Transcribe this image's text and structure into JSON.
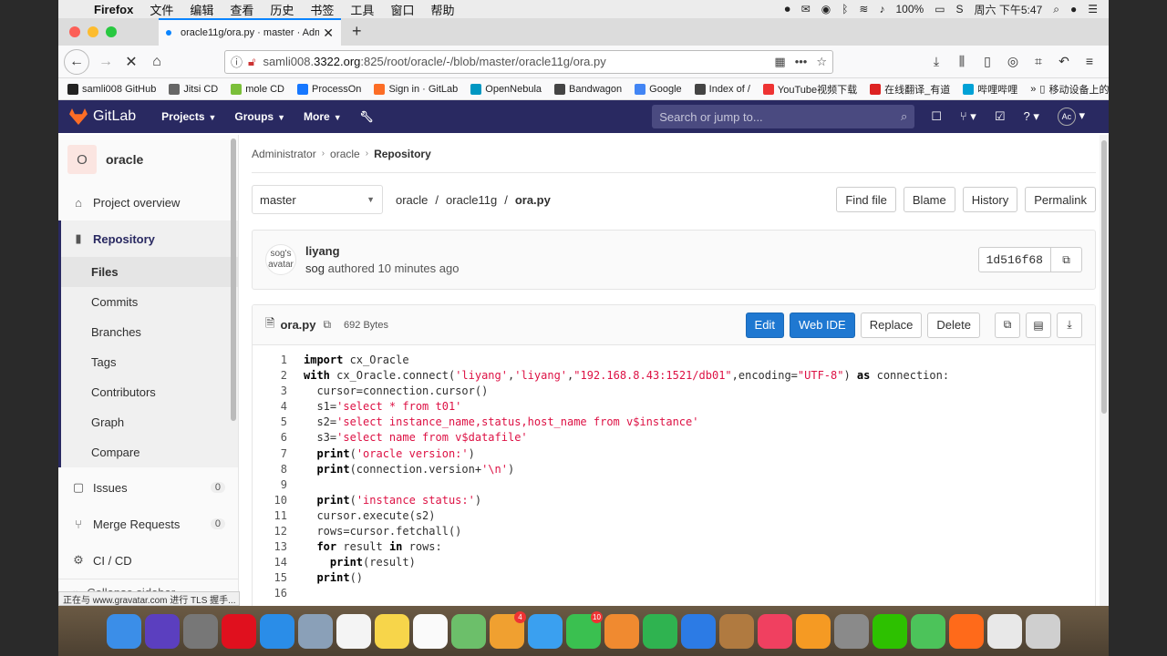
{
  "menubar": {
    "app": "Firefox",
    "items": [
      "文件",
      "编辑",
      "查看",
      "历史",
      "书签",
      "工具",
      "窗口",
      "帮助"
    ],
    "battery": "100%",
    "clock": "周六 下午5:47"
  },
  "browser": {
    "tab_title": "oracle11g/ora.py · master · Adm",
    "url_prefix": "samli008.",
    "url_host": "3322.org",
    "url_rest": ":825/root/oracle/-/blob/master/oracle11g/ora.py",
    "bookmarks": [
      {
        "label": "samli008 GitHub",
        "color": "#222"
      },
      {
        "label": "Jitsi CD",
        "color": "#666"
      },
      {
        "label": "mole CD",
        "color": "#7bbf3a"
      },
      {
        "label": "ProcessOn",
        "color": "#1677ff"
      },
      {
        "label": "Sign in · GitLab",
        "color": "#fc6d26"
      },
      {
        "label": "OpenNebula",
        "color": "#0097c2"
      },
      {
        "label": "Bandwagon",
        "color": "#444"
      },
      {
        "label": "Google",
        "color": "#4285f4"
      },
      {
        "label": "Index of /",
        "color": "#444"
      },
      {
        "label": "YouTube视频下载",
        "color": "#e33"
      },
      {
        "label": "在线翻译_有道",
        "color": "#d22"
      },
      {
        "label": "哔哩哔哩",
        "color": "#00a1d6"
      }
    ],
    "bookmarks_more": "移动设备上的书签",
    "status": "正在与 www.gravatar.com 进行 TLS 握手..."
  },
  "gitlab": {
    "brand": "GitLab",
    "menu": [
      "Projects",
      "Groups",
      "More"
    ],
    "search_placeholder": "Search or jump to...",
    "user_initials": "Ac",
    "project_initial": "O",
    "project_name": "oracle",
    "sidebar": {
      "overview": "Project overview",
      "repository": "Repository",
      "sub": [
        "Files",
        "Commits",
        "Branches",
        "Tags",
        "Contributors",
        "Graph",
        "Compare"
      ],
      "issues": "Issues",
      "issues_count": "0",
      "merge_requests": "Merge Requests",
      "mr_count": "0",
      "cicd": "CI / CD",
      "collapse": "Collapse sidebar"
    },
    "breadcrumb": [
      "Administrator",
      "oracle",
      "Repository"
    ],
    "branch": "master",
    "path": [
      "oracle",
      "oracle11g",
      "ora.py"
    ],
    "actions": [
      "Find file",
      "Blame",
      "History",
      "Permalink"
    ],
    "commit": {
      "avatar_alt": "sog's avatar",
      "title": "liyang",
      "author": "sog",
      "meta": "authored 10 minutes ago",
      "sha": "1d516f68"
    },
    "file": {
      "name": "ora.py",
      "size": "692 Bytes",
      "edit": "Edit",
      "webide": "Web IDE",
      "replace": "Replace",
      "delete": "Delete"
    }
  },
  "code": [
    [
      {
        "k": "import"
      },
      {
        "t": " cx_Oracle"
      }
    ],
    [
      {
        "k": "with"
      },
      {
        "t": " cx_Oracle.connect("
      },
      {
        "s": "'liyang'"
      },
      {
        "t": ","
      },
      {
        "s": "'liyang'"
      },
      {
        "t": ","
      },
      {
        "s": "\"192.168.8.43:1521/db01\""
      },
      {
        "t": ",encoding="
      },
      {
        "s": "\"UTF-8\""
      },
      {
        "t": ") "
      },
      {
        "k": "as"
      },
      {
        "t": " connection:"
      }
    ],
    [
      {
        "t": "  cursor=connection.cursor()"
      }
    ],
    [
      {
        "t": "  s1="
      },
      {
        "s": "'select * from t01'"
      }
    ],
    [
      {
        "t": "  s2="
      },
      {
        "s": "'select instance_name,status,host_name from v$instance'"
      }
    ],
    [
      {
        "t": "  s3="
      },
      {
        "s": "'select name from v$datafile'"
      }
    ],
    [
      {
        "t": "  "
      },
      {
        "k": "print"
      },
      {
        "t": "("
      },
      {
        "s": "'oracle version:'"
      },
      {
        "t": ")"
      }
    ],
    [
      {
        "t": "  "
      },
      {
        "k": "print"
      },
      {
        "t": "(connection.version+"
      },
      {
        "s": "'\\n'"
      },
      {
        "t": ")"
      }
    ],
    [
      {
        "t": ""
      }
    ],
    [
      {
        "t": "  "
      },
      {
        "k": "print"
      },
      {
        "t": "("
      },
      {
        "s": "'instance status:'"
      },
      {
        "t": ")"
      }
    ],
    [
      {
        "t": "  cursor.execute(s2)"
      }
    ],
    [
      {
        "t": "  rows=cursor.fetchall()"
      }
    ],
    [
      {
        "t": "  "
      },
      {
        "k": "for"
      },
      {
        "t": " result "
      },
      {
        "k": "in"
      },
      {
        "t": " rows:"
      }
    ],
    [
      {
        "t": "    "
      },
      {
        "k": "print"
      },
      {
        "t": "(result)"
      }
    ],
    [
      {
        "t": "  "
      },
      {
        "k": "print"
      },
      {
        "t": "()"
      }
    ],
    [
      {
        "t": ""
      }
    ]
  ],
  "dock": [
    {
      "name": "finder-icon",
      "color": "#3b8ee8",
      "badge": ""
    },
    {
      "name": "siri-icon",
      "color": "#5b3fbf",
      "badge": ""
    },
    {
      "name": "launchpad-icon",
      "color": "#777",
      "badge": ""
    },
    {
      "name": "opera-icon",
      "color": "#e0101e",
      "badge": ""
    },
    {
      "name": "safari-icon",
      "color": "#2a8de8",
      "badge": ""
    },
    {
      "name": "preview-icon",
      "color": "#8aa0b8",
      "badge": ""
    },
    {
      "name": "calendar-icon",
      "color": "#f4f4f4",
      "badge": ""
    },
    {
      "name": "notes-icon",
      "color": "#f7d54a",
      "badge": ""
    },
    {
      "name": "reminders-icon",
      "color": "#fafafa",
      "badge": ""
    },
    {
      "name": "maps-icon",
      "color": "#6cbf6a",
      "badge": ""
    },
    {
      "name": "photos-icon",
      "color": "#f0a030",
      "badge": "4"
    },
    {
      "name": "messages-icon",
      "color": "#3aa0f0",
      "badge": ""
    },
    {
      "name": "facetime-icon",
      "color": "#3ac050",
      "badge": "10"
    },
    {
      "name": "pages-icon",
      "color": "#f08a30",
      "badge": ""
    },
    {
      "name": "numbers-icon",
      "color": "#2fb350",
      "badge": ""
    },
    {
      "name": "keynote-icon",
      "color": "#2c7be5",
      "badge": ""
    },
    {
      "name": "books-icon",
      "color": "#b07a40",
      "badge": ""
    },
    {
      "name": "music-icon",
      "color": "#f04060",
      "badge": ""
    },
    {
      "name": "ibooks-icon",
      "color": "#f59a23",
      "badge": ""
    },
    {
      "name": "system-preferences-icon",
      "color": "#8a8a8a",
      "badge": ""
    },
    {
      "name": "wechat-icon",
      "color": "#2dc100",
      "badge": ""
    },
    {
      "name": "chat-icon",
      "color": "#4cc35a",
      "badge": ""
    },
    {
      "name": "firefox-icon",
      "color": "#ff6a1a",
      "badge": ""
    },
    {
      "name": "documents-icon",
      "color": "#e8e8e8",
      "badge": ""
    },
    {
      "name": "trash-icon",
      "color": "#cfcfcf",
      "badge": ""
    }
  ]
}
